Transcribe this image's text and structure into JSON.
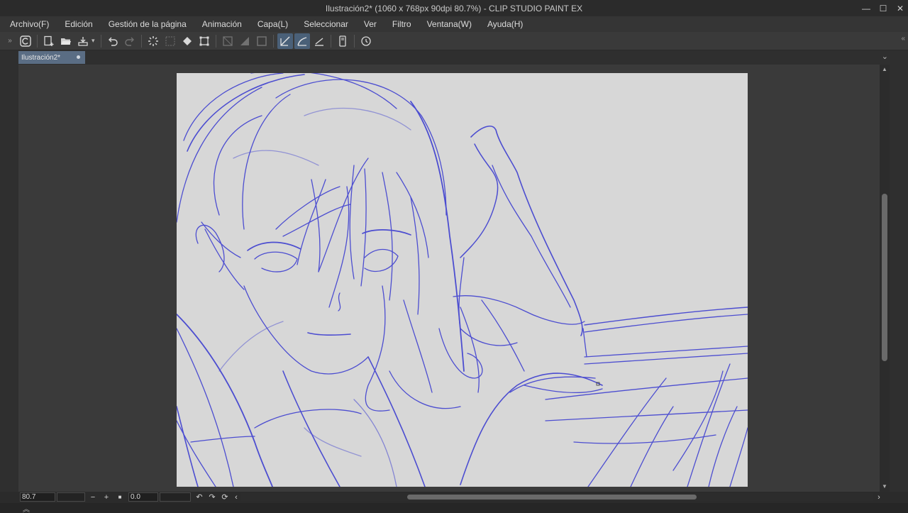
{
  "window": {
    "title": "Ilustración2* (1060 x 768px 90dpi 80.7%)  - CLIP STUDIO PAINT EX",
    "minimize_glyph": "—",
    "maximize_glyph": "☐",
    "close_glyph": "✕"
  },
  "menu": [
    "Archivo(F)",
    "Edición",
    "Gestión de la página",
    "Animación",
    "Capa(L)",
    "Seleccionar",
    "Ver",
    "Filtro",
    "Ventana(W)",
    "Ayuda(H)"
  ],
  "toolbar": {
    "left_chevron": "»",
    "right_chevron": "«",
    "icons": [
      "clip-studio-icon",
      "new-canvas-icon",
      "open-folder-icon",
      "save-icon",
      "undo-icon",
      "redo-icon",
      "loading-icon",
      "transform-icon",
      "fill-icon",
      "crop-icon",
      "stabilizer-icon",
      "snap-ruler-icon",
      "snap-curve-icon",
      "snap-special-icon",
      "device-icon",
      "settings-icon"
    ]
  },
  "tab": {
    "label": "Ilustración2*",
    "more_glyph": "⌄"
  },
  "bottom": {
    "zoom_value": "80.7",
    "zoom_out_glyph": "−",
    "zoom_in_glyph": "+",
    "fit_glyph": "■",
    "rotation_value": "0.0",
    "rotate_left_glyph": "↶",
    "rotate_right_glyph": "↷",
    "reset_rotation_glyph": "⟳",
    "scroll_left_glyph": "‹",
    "scroll_right_glyph": "›",
    "expand_glyph": "︽"
  },
  "colors": {
    "sketch_stroke": "#3d3fd0",
    "paper": "#d7d7d7",
    "active_tab": "#5a6d84"
  }
}
